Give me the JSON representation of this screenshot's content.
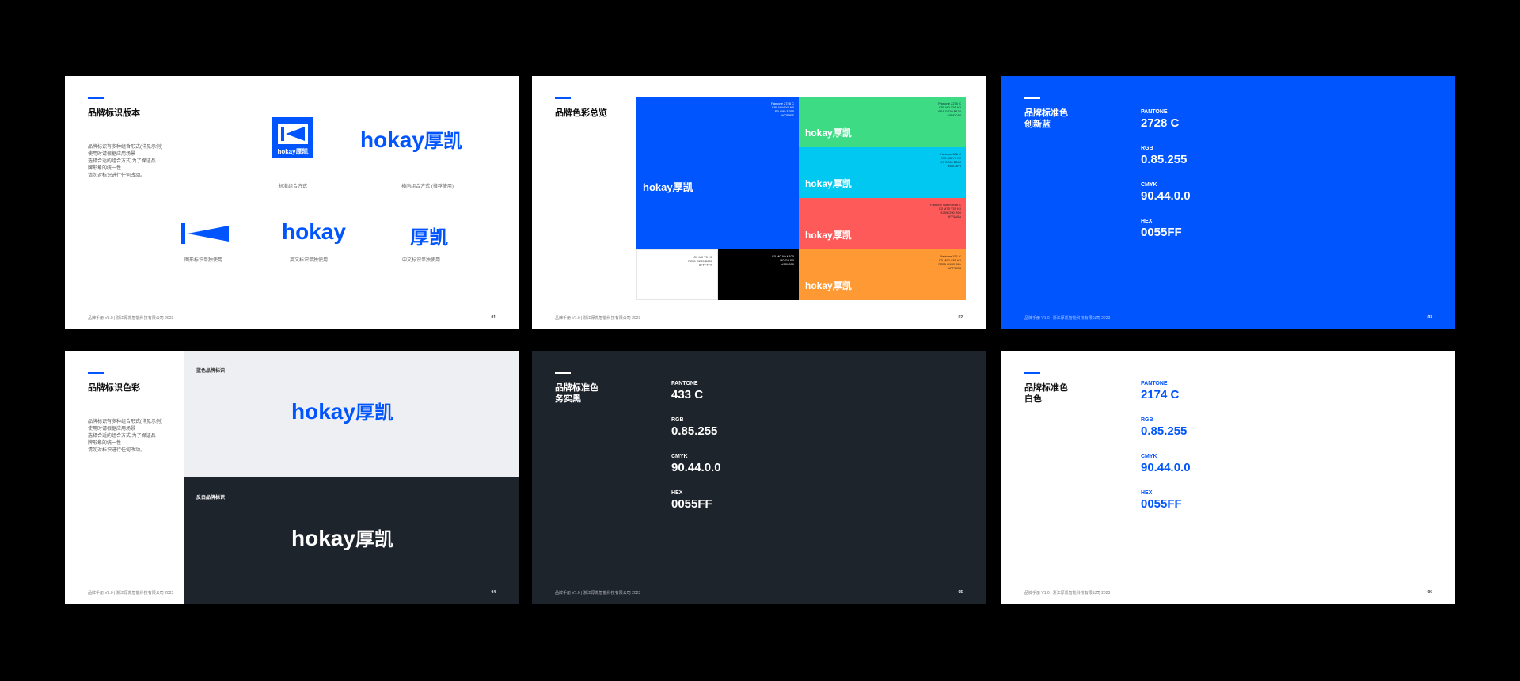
{
  "colors": {
    "brand_blue": "#0055ff",
    "dark": "#1e242c",
    "green": "#3ddc84",
    "cyan": "#00c8f0",
    "red": "#ff5a5a",
    "orange": "#ff9933",
    "black": "#000000",
    "white": "#ffffff"
  },
  "wordmark": {
    "latin": "hokay",
    "cn": "厚凯"
  },
  "slide1": {
    "title": "品牌标识版本",
    "desc": "品牌标识有多种组合形式(详见示例)\n使用时请根据应用场景\n选择合适的组合方式,为了保证品\n牌形象的统一性\n请勿对标识进行任何改动。",
    "captions": [
      "标准组合方式",
      "横向组合方式 (推荐使用)",
      "图形标识单独使用",
      "英文标识单独使用",
      "中文标识单独使用"
    ],
    "footer": "品牌手册 V1.0  |  浙江厚凯智能科技有限公司  2023",
    "page": "01"
  },
  "slide2": {
    "title": "品牌色彩总览",
    "swatches": [
      "Pantone 2728 C\nC90 M44 Y0 K0\nR0 G85 B255\n#0055FF",
      "Pantone 2270 C\nC55 M0 Y55 K0\nR61 G220 B132\n#3DDC84",
      "Pantone 306 C\nC70 M0 Y5 K0\nR0 G200 B240\n#00C8F0",
      "Pantone Warm Red C\nC0 M75 Y55 K0\nR255 G90 B90\n#FF5A5A",
      "Pantone 151 C\nC0 M50 Y85 K0\nR255 G153 B51\n#FF9933",
      "C0 M0 Y0 K0\nR255 G255 B255\n#FFFFFF",
      "C0 M0 Y0 K100\nR0 G0 B0\n#000000"
    ],
    "footer": "品牌手册 V1.0  |  浙江厚凯智能科技有限公司  2023",
    "page": "02"
  },
  "slide3": {
    "title": "品牌标准色\n创新蓝",
    "specs": [
      {
        "label": "PANTONE",
        "value": "2728 C"
      },
      {
        "label": "RGB",
        "value": "0.85.255"
      },
      {
        "label": "CMYK",
        "value": "90.44.0.0"
      },
      {
        "label": "HEX",
        "value": "0055FF"
      }
    ],
    "footer": "品牌手册 V1.0  |  浙江厚凯智能科技有限公司  2023",
    "page": "03"
  },
  "slide4": {
    "title": "品牌标识色彩",
    "desc": "品牌标识有多种组合形式(详见示例)\n使用时请根据应用场景\n选择合适的组合方式,为了保证品\n牌形象的统一性\n请勿对标识进行任何改动。",
    "panel_top_label": "蓝色品牌标识",
    "panel_bottom_label": "反白品牌标识",
    "footer": "品牌手册 V1.0  |  浙江厚凯智能科技有限公司  2023",
    "page": "04"
  },
  "slide5": {
    "title": "品牌标准色\n务实黑",
    "specs": [
      {
        "label": "PANTONE",
        "value": "433 C"
      },
      {
        "label": "RGB",
        "value": "0.85.255"
      },
      {
        "label": "CMYK",
        "value": "90.44.0.0"
      },
      {
        "label": "HEX",
        "value": "0055FF"
      }
    ],
    "footer": "品牌手册 V1.0  |  浙江厚凯智能科技有限公司  2023",
    "page": "05"
  },
  "slide6": {
    "title": "品牌标准色\n白色",
    "specs": [
      {
        "label": "PANTONE",
        "value": "2174 C"
      },
      {
        "label": "RGB",
        "value": "0.85.255"
      },
      {
        "label": "CMYK",
        "value": "90.44.0.0"
      },
      {
        "label": "HEX",
        "value": "0055FF"
      }
    ],
    "footer": "品牌手册 V1.0  |  浙江厚凯智能科技有限公司  2023",
    "page": "06"
  }
}
